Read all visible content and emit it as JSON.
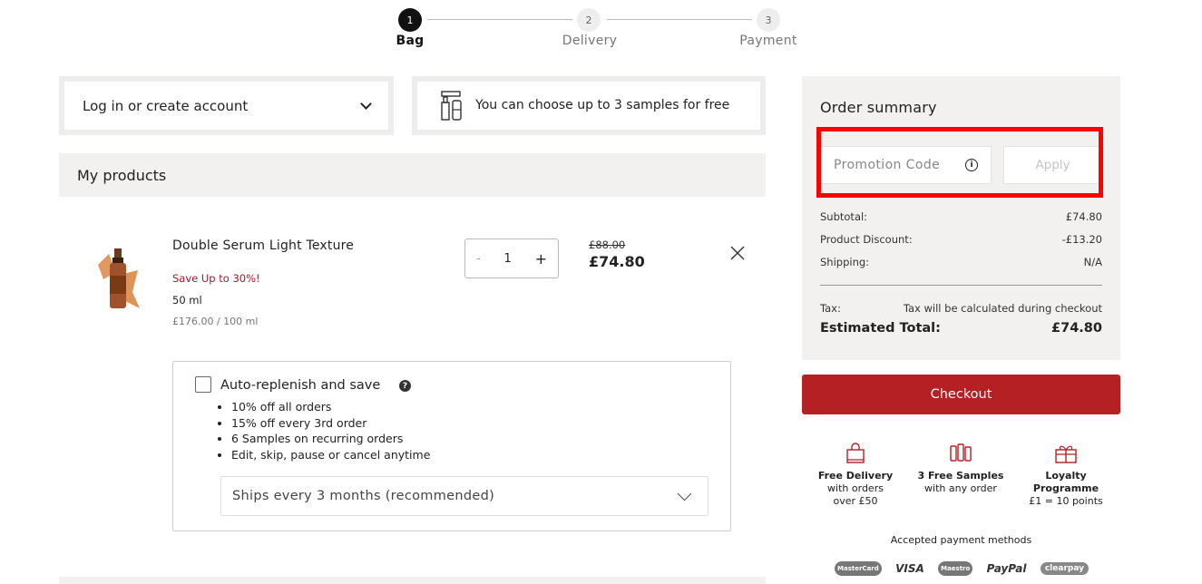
{
  "stepper": {
    "steps": [
      {
        "number": "1",
        "label": "Bag"
      },
      {
        "number": "2",
        "label": "Delivery"
      },
      {
        "number": "3",
        "label": "Payment"
      }
    ]
  },
  "login": {
    "label": "Log in or create account"
  },
  "samples": {
    "label": "You can choose up to 3 samples for free"
  },
  "products": {
    "header": "My products",
    "item": {
      "name": "Double Serum Light Texture",
      "promo": "Save Up to 30%!",
      "size": "50 ml",
      "unit_price": "£176.00 / 100 ml",
      "quantity": "1",
      "minus": "-",
      "plus": "+",
      "old_price": "£88.00",
      "price": "£74.80"
    }
  },
  "replenish": {
    "title": "Auto-replenish and save",
    "help": "?",
    "benefits": [
      "10% off all orders",
      "15% off every 3rd order",
      "6 Samples on recurring orders",
      "Edit, skip, pause or cancel anytime"
    ],
    "frequency": "Ships every 3 months (recommended)"
  },
  "summary": {
    "title": "Order summary",
    "promo_placeholder": "Promotion Code",
    "info": "i",
    "apply": "Apply",
    "rows": [
      {
        "label": "Subtotal:",
        "value": "£74.80"
      },
      {
        "label": "Product Discount:",
        "value": "-£13.20"
      },
      {
        "label": "Shipping:",
        "value": "N/A"
      }
    ],
    "tax_label": "Tax:",
    "tax_value": "Tax will be calculated during checkout",
    "total_label": "Estimated Total:",
    "total_value": "£74.80"
  },
  "checkout": {
    "label": "Checkout"
  },
  "perks": [
    {
      "title": "Free Delivery",
      "line1": "with orders",
      "line2": "over £50",
      "icon": "shopping-bag-icon"
    },
    {
      "title": "3 Free Samples",
      "line1": "with any order",
      "line2": "",
      "icon": "sample-bottles-icon"
    },
    {
      "title": "Loyalty",
      "line1": "Programme",
      "line2": "£1 = 10 points",
      "icon": "gift-icon"
    }
  ],
  "payment": {
    "label": "Accepted payment methods",
    "methods": [
      "MasterCard",
      "VISA",
      "Maestro",
      "PayPal",
      "clearpay"
    ]
  },
  "colors": {
    "accent": "#b52025",
    "promo_text": "#a01c2c",
    "highlight": "#ff0000",
    "summary_bg": "#f2f1ef"
  }
}
